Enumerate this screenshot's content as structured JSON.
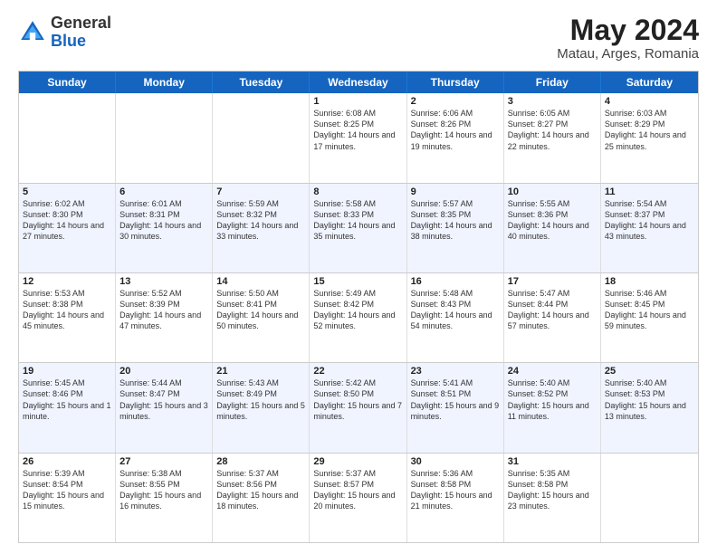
{
  "header": {
    "logo_general": "General",
    "logo_blue": "Blue",
    "month_year": "May 2024",
    "location": "Matau, Arges, Romania"
  },
  "days_of_week": [
    "Sunday",
    "Monday",
    "Tuesday",
    "Wednesday",
    "Thursday",
    "Friday",
    "Saturday"
  ],
  "weeks": [
    [
      {
        "day": "",
        "sunrise": "",
        "sunset": "",
        "daylight": ""
      },
      {
        "day": "",
        "sunrise": "",
        "sunset": "",
        "daylight": ""
      },
      {
        "day": "",
        "sunrise": "",
        "sunset": "",
        "daylight": ""
      },
      {
        "day": "1",
        "sunrise": "Sunrise: 6:08 AM",
        "sunset": "Sunset: 8:25 PM",
        "daylight": "Daylight: 14 hours and 17 minutes."
      },
      {
        "day": "2",
        "sunrise": "Sunrise: 6:06 AM",
        "sunset": "Sunset: 8:26 PM",
        "daylight": "Daylight: 14 hours and 19 minutes."
      },
      {
        "day": "3",
        "sunrise": "Sunrise: 6:05 AM",
        "sunset": "Sunset: 8:27 PM",
        "daylight": "Daylight: 14 hours and 22 minutes."
      },
      {
        "day": "4",
        "sunrise": "Sunrise: 6:03 AM",
        "sunset": "Sunset: 8:29 PM",
        "daylight": "Daylight: 14 hours and 25 minutes."
      }
    ],
    [
      {
        "day": "5",
        "sunrise": "Sunrise: 6:02 AM",
        "sunset": "Sunset: 8:30 PM",
        "daylight": "Daylight: 14 hours and 27 minutes."
      },
      {
        "day": "6",
        "sunrise": "Sunrise: 6:01 AM",
        "sunset": "Sunset: 8:31 PM",
        "daylight": "Daylight: 14 hours and 30 minutes."
      },
      {
        "day": "7",
        "sunrise": "Sunrise: 5:59 AM",
        "sunset": "Sunset: 8:32 PM",
        "daylight": "Daylight: 14 hours and 33 minutes."
      },
      {
        "day": "8",
        "sunrise": "Sunrise: 5:58 AM",
        "sunset": "Sunset: 8:33 PM",
        "daylight": "Daylight: 14 hours and 35 minutes."
      },
      {
        "day": "9",
        "sunrise": "Sunrise: 5:57 AM",
        "sunset": "Sunset: 8:35 PM",
        "daylight": "Daylight: 14 hours and 38 minutes."
      },
      {
        "day": "10",
        "sunrise": "Sunrise: 5:55 AM",
        "sunset": "Sunset: 8:36 PM",
        "daylight": "Daylight: 14 hours and 40 minutes."
      },
      {
        "day": "11",
        "sunrise": "Sunrise: 5:54 AM",
        "sunset": "Sunset: 8:37 PM",
        "daylight": "Daylight: 14 hours and 43 minutes."
      }
    ],
    [
      {
        "day": "12",
        "sunrise": "Sunrise: 5:53 AM",
        "sunset": "Sunset: 8:38 PM",
        "daylight": "Daylight: 14 hours and 45 minutes."
      },
      {
        "day": "13",
        "sunrise": "Sunrise: 5:52 AM",
        "sunset": "Sunset: 8:39 PM",
        "daylight": "Daylight: 14 hours and 47 minutes."
      },
      {
        "day": "14",
        "sunrise": "Sunrise: 5:50 AM",
        "sunset": "Sunset: 8:41 PM",
        "daylight": "Daylight: 14 hours and 50 minutes."
      },
      {
        "day": "15",
        "sunrise": "Sunrise: 5:49 AM",
        "sunset": "Sunset: 8:42 PM",
        "daylight": "Daylight: 14 hours and 52 minutes."
      },
      {
        "day": "16",
        "sunrise": "Sunrise: 5:48 AM",
        "sunset": "Sunset: 8:43 PM",
        "daylight": "Daylight: 14 hours and 54 minutes."
      },
      {
        "day": "17",
        "sunrise": "Sunrise: 5:47 AM",
        "sunset": "Sunset: 8:44 PM",
        "daylight": "Daylight: 14 hours and 57 minutes."
      },
      {
        "day": "18",
        "sunrise": "Sunrise: 5:46 AM",
        "sunset": "Sunset: 8:45 PM",
        "daylight": "Daylight: 14 hours and 59 minutes."
      }
    ],
    [
      {
        "day": "19",
        "sunrise": "Sunrise: 5:45 AM",
        "sunset": "Sunset: 8:46 PM",
        "daylight": "Daylight: 15 hours and 1 minute."
      },
      {
        "day": "20",
        "sunrise": "Sunrise: 5:44 AM",
        "sunset": "Sunset: 8:47 PM",
        "daylight": "Daylight: 15 hours and 3 minutes."
      },
      {
        "day": "21",
        "sunrise": "Sunrise: 5:43 AM",
        "sunset": "Sunset: 8:49 PM",
        "daylight": "Daylight: 15 hours and 5 minutes."
      },
      {
        "day": "22",
        "sunrise": "Sunrise: 5:42 AM",
        "sunset": "Sunset: 8:50 PM",
        "daylight": "Daylight: 15 hours and 7 minutes."
      },
      {
        "day": "23",
        "sunrise": "Sunrise: 5:41 AM",
        "sunset": "Sunset: 8:51 PM",
        "daylight": "Daylight: 15 hours and 9 minutes."
      },
      {
        "day": "24",
        "sunrise": "Sunrise: 5:40 AM",
        "sunset": "Sunset: 8:52 PM",
        "daylight": "Daylight: 15 hours and 11 minutes."
      },
      {
        "day": "25",
        "sunrise": "Sunrise: 5:40 AM",
        "sunset": "Sunset: 8:53 PM",
        "daylight": "Daylight: 15 hours and 13 minutes."
      }
    ],
    [
      {
        "day": "26",
        "sunrise": "Sunrise: 5:39 AM",
        "sunset": "Sunset: 8:54 PM",
        "daylight": "Daylight: 15 hours and 15 minutes."
      },
      {
        "day": "27",
        "sunrise": "Sunrise: 5:38 AM",
        "sunset": "Sunset: 8:55 PM",
        "daylight": "Daylight: 15 hours and 16 minutes."
      },
      {
        "day": "28",
        "sunrise": "Sunrise: 5:37 AM",
        "sunset": "Sunset: 8:56 PM",
        "daylight": "Daylight: 15 hours and 18 minutes."
      },
      {
        "day": "29",
        "sunrise": "Sunrise: 5:37 AM",
        "sunset": "Sunset: 8:57 PM",
        "daylight": "Daylight: 15 hours and 20 minutes."
      },
      {
        "day": "30",
        "sunrise": "Sunrise: 5:36 AM",
        "sunset": "Sunset: 8:58 PM",
        "daylight": "Daylight: 15 hours and 21 minutes."
      },
      {
        "day": "31",
        "sunrise": "Sunrise: 5:35 AM",
        "sunset": "Sunset: 8:58 PM",
        "daylight": "Daylight: 15 hours and 23 minutes."
      },
      {
        "day": "",
        "sunrise": "",
        "sunset": "",
        "daylight": ""
      }
    ]
  ]
}
